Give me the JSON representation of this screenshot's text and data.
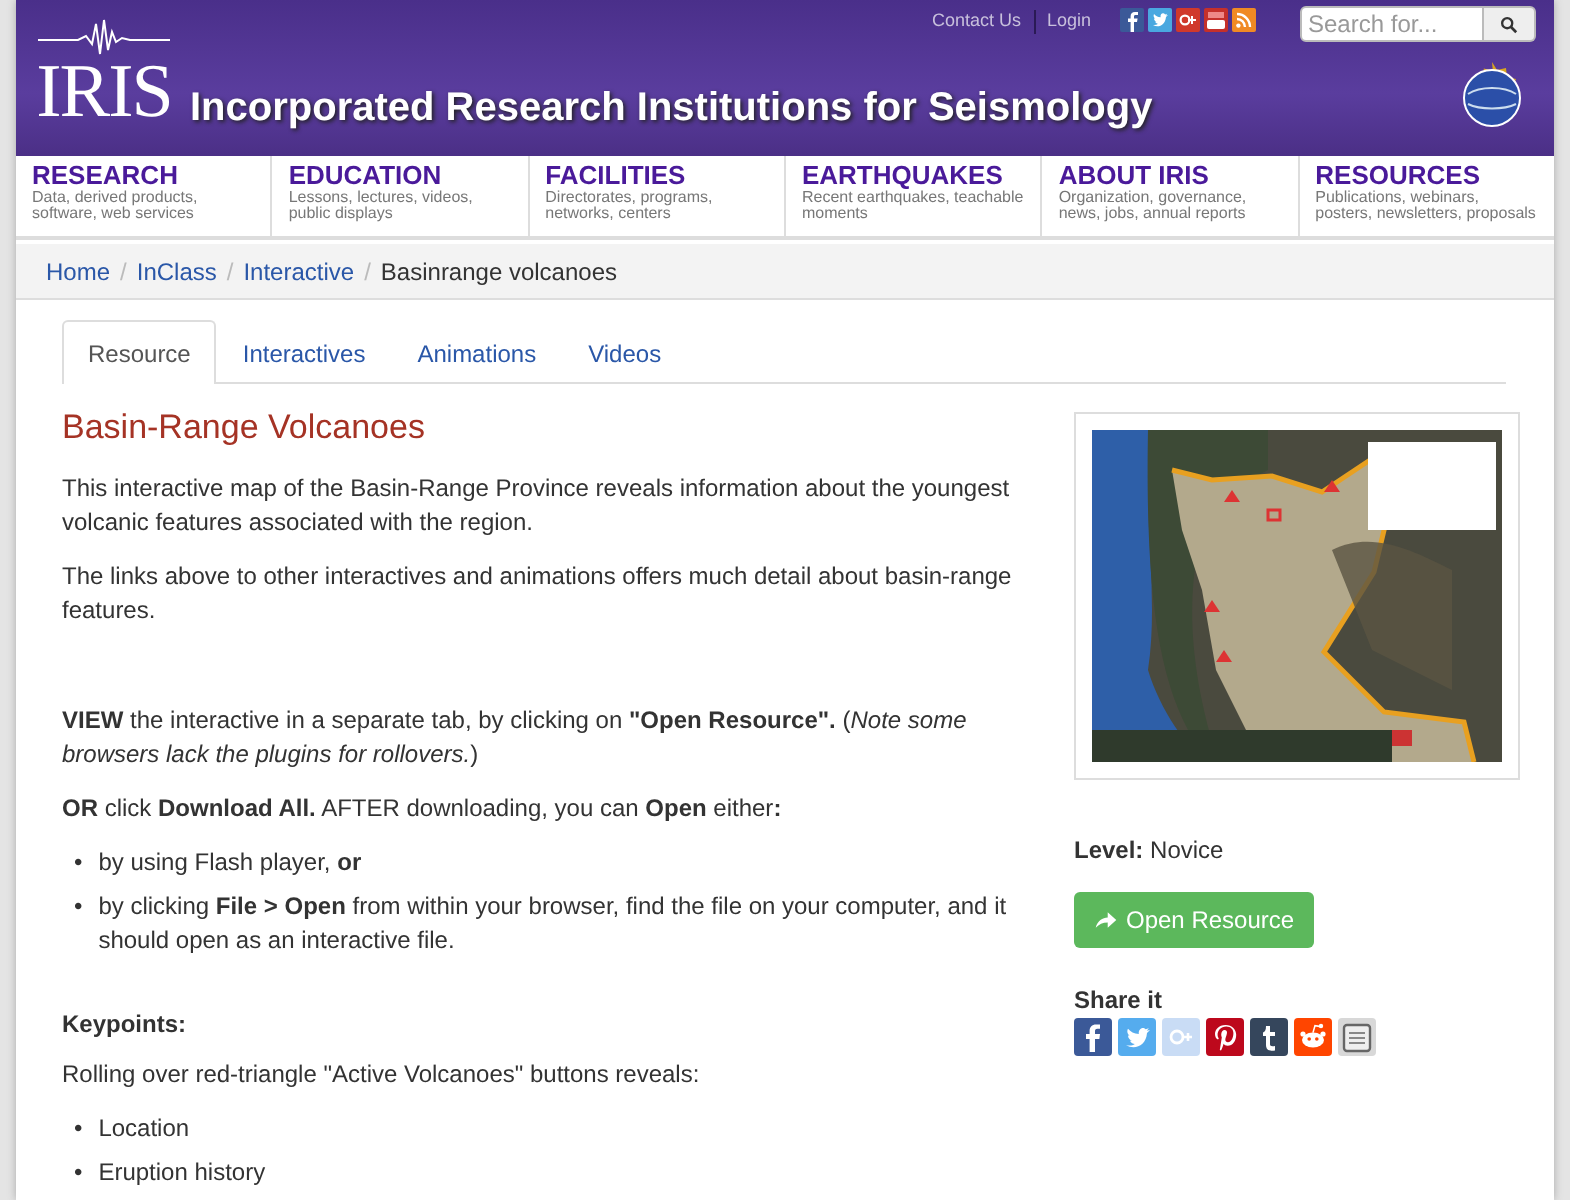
{
  "header": {
    "logo": "IRIS",
    "title": "Incorporated Research Institutions for Seismology",
    "top_links": [
      "Contact Us",
      "Login"
    ],
    "search": {
      "placeholder": "Search for..."
    }
  },
  "nav": [
    {
      "title": "RESEARCH",
      "subtitle": "Data, derived products, software, web services"
    },
    {
      "title": "EDUCATION",
      "subtitle": "Lessons, lectures, videos, public displays"
    },
    {
      "title": "FACILITIES",
      "subtitle": "Directorates, programs, networks, centers"
    },
    {
      "title": "EARTHQUAKES",
      "subtitle": "Recent earthquakes, teachable moments"
    },
    {
      "title": "ABOUT IRIS",
      "subtitle": "Organization, governance, news, jobs, annual reports"
    },
    {
      "title": "RESOURCES",
      "subtitle": "Publications, webinars, posters, newsletters, proposals"
    }
  ],
  "breadcrumb_separator": "/",
  "breadcrumb": [
    {
      "label": "Home",
      "current": false
    },
    {
      "label": "InClass",
      "current": false
    },
    {
      "label": "Interactive",
      "current": false
    },
    {
      "label": "Basinrange volcanoes",
      "current": true
    }
  ],
  "tabs": [
    {
      "label": "Resource",
      "selected": true
    },
    {
      "label": "Interactives",
      "selected": false
    },
    {
      "label": "Animations",
      "selected": false
    },
    {
      "label": "Videos",
      "selected": false
    }
  ],
  "heading": "Basin-Range Volcanoes",
  "content": [
    {
      "kind": "paragraph",
      "text": "This interactive map of the Basin-Range Province reveals information about the youngest volcanic features associated with the region."
    },
    {
      "kind": "paragraph",
      "text": "The links above to other interactives and animations offers much detail about basin-range features."
    },
    {
      "kind": "spacer"
    },
    {
      "kind": "paragraph",
      "text": "**VIEW** the interactive in a separate tab, by clicking on **\"Open Resource\".** (*Note some browsers lack the plugins for rollovers.*)"
    },
    {
      "kind": "paragraph",
      "text": "**OR** click **Download All.**  AFTER downloading, you can **Open** either**:**"
    },
    {
      "kind": "bullets",
      "marker": "•",
      "items": [
        " by using Flash player, **or**",
        " by clicking **File > Open** from within your browser, find the file on your computer, and it should open as an interactive file."
      ]
    },
    {
      "kind": "subheading",
      "text": "Keypoints:"
    },
    {
      "kind": "paragraph",
      "text": "Rolling over red-triangle \"Active Volcanoes\" buttons reveals:"
    },
    {
      "kind": "bullets",
      "marker": "•",
      "items": [
        "Location",
        "Eruption history"
      ]
    }
  ],
  "sidebar": {
    "level_label": "Level:",
    "level": "Novice",
    "button": "Open Resource",
    "share_title": "Share it"
  }
}
